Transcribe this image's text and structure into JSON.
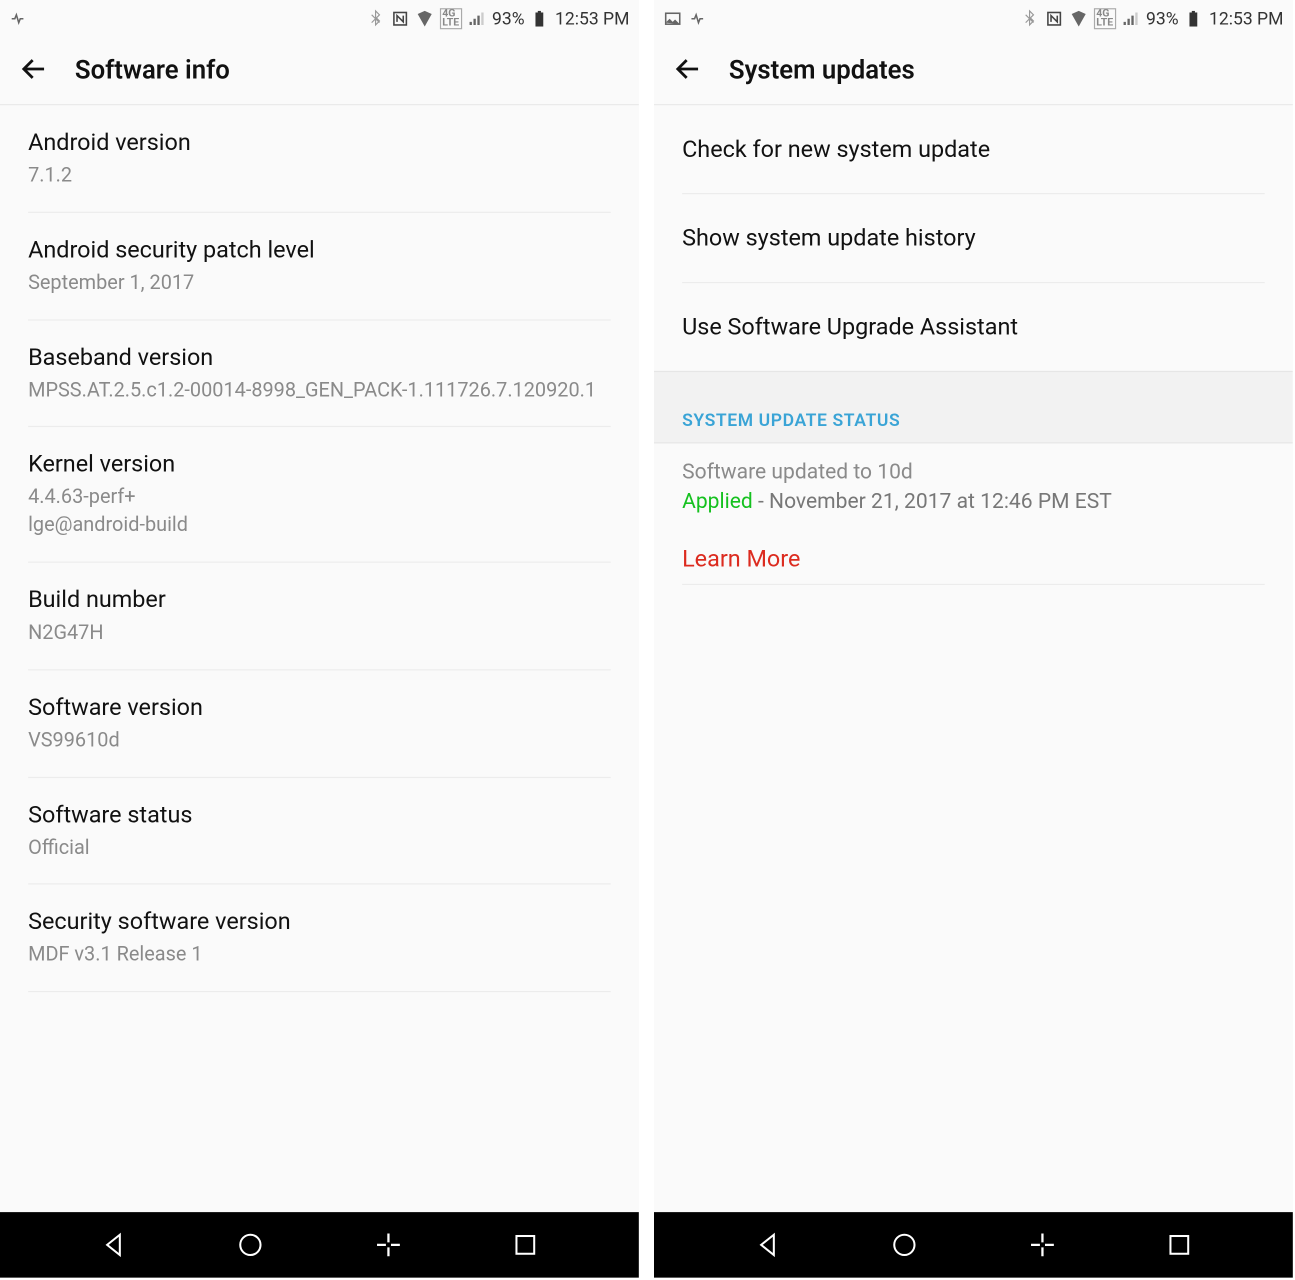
{
  "statusbar": {
    "battery_pct": "93%",
    "time": "12:53 PM"
  },
  "left": {
    "title": "Software info",
    "items": [
      {
        "title": "Android version",
        "sub": "7.1.2"
      },
      {
        "title": "Android security patch level",
        "sub": "September 1, 2017"
      },
      {
        "title": "Baseband version",
        "sub": "MPSS.AT.2.5.c1.2-00014-8998_GEN_PACK-1.111726.7.120920.1"
      },
      {
        "title": "Kernel version",
        "sub": "4.4.63-perf+\nlge@android-build"
      },
      {
        "title": "Build number",
        "sub": "N2G47H"
      },
      {
        "title": "Software version",
        "sub": "VS99610d"
      },
      {
        "title": "Software status",
        "sub": "Official"
      },
      {
        "title": "Security software version",
        "sub": "MDF v3.1 Release 1"
      }
    ]
  },
  "right": {
    "title": "System updates",
    "actions": [
      "Check for new system update",
      "Show system update history",
      "Use Software Upgrade Assistant"
    ],
    "section_header": "SYSTEM UPDATE STATUS",
    "status_line1": "Software updated to 10d",
    "status_applied": "Applied",
    "status_date": " - November 21, 2017 at 12:46 PM EST",
    "learn_more": "Learn More"
  }
}
